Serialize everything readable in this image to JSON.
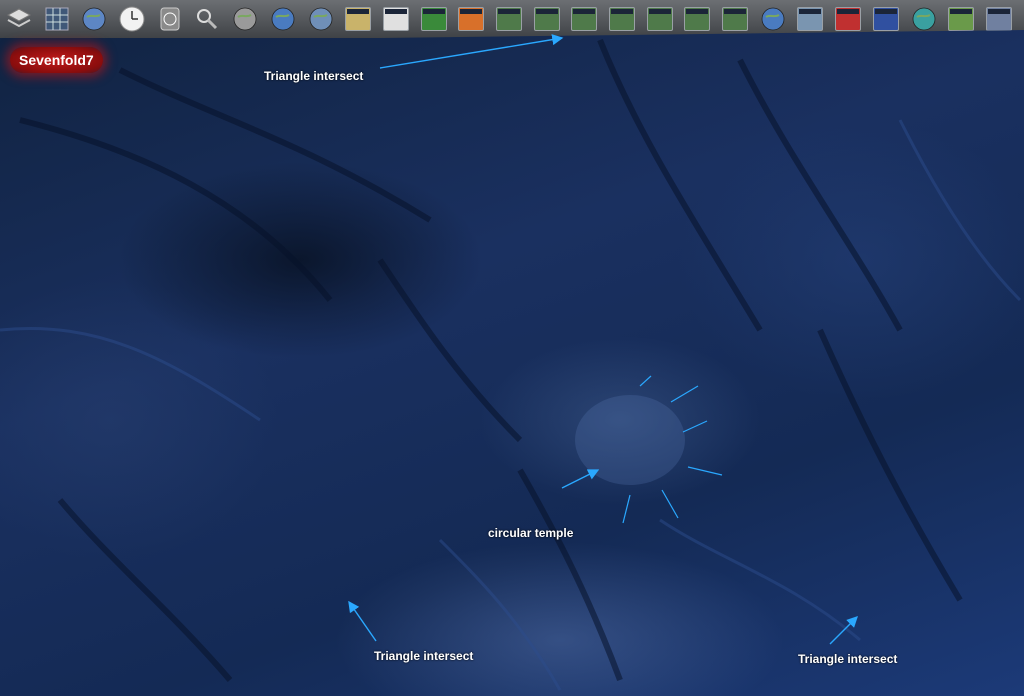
{
  "toolbar": {
    "tools": [
      {
        "id": "layers",
        "icon": "layers-icon"
      },
      {
        "id": "grid",
        "icon": "latlon-grid-icon"
      },
      {
        "id": "globe-grid",
        "icon": "globe-grid-icon"
      },
      {
        "id": "clock",
        "icon": "clock-icon"
      },
      {
        "id": "compass",
        "icon": "compass-icon"
      },
      {
        "id": "search",
        "icon": "magnifier-icon"
      },
      {
        "id": "moon",
        "icon": "moon-icon"
      },
      {
        "id": "earth",
        "icon": "earth-icon"
      },
      {
        "id": "globe2",
        "icon": "globe-icon"
      },
      {
        "id": "satellite",
        "icon": "satellite-icon"
      },
      {
        "id": "modis",
        "icon": "modis-icon"
      },
      {
        "id": "wms",
        "icon": "wms-icon"
      },
      {
        "id": "weather",
        "icon": "weather-map-icon"
      },
      {
        "id": "landsat1",
        "icon": "imagery-thumbnail-icon"
      },
      {
        "id": "landsat2",
        "icon": "imagery-thumbnail-icon"
      },
      {
        "id": "landsat3",
        "icon": "imagery-thumbnail-icon"
      },
      {
        "id": "landsat4",
        "icon": "imagery-thumbnail-icon"
      },
      {
        "id": "landsat5",
        "icon": "imagery-thumbnail-icon"
      },
      {
        "id": "landsat6",
        "icon": "imagery-thumbnail-icon"
      },
      {
        "id": "landsat7",
        "icon": "imagery-thumbnail-icon"
      },
      {
        "id": "globe3",
        "icon": "earth-icon"
      },
      {
        "id": "usgs",
        "icon": "topo-map-icon"
      },
      {
        "id": "flags1",
        "icon": "world-flags-icon"
      },
      {
        "id": "flags2",
        "icon": "country-flags-icon"
      },
      {
        "id": "community",
        "icon": "community-globe-icon"
      },
      {
        "id": "usmap",
        "icon": "us-map-icon"
      },
      {
        "id": "tools",
        "icon": "tools-icon"
      }
    ]
  },
  "badge": {
    "label": "Sevenfold7"
  },
  "annotations": {
    "top": "Triangle intersect",
    "center": "circular temple",
    "bottom_left": "Triangle intersect",
    "bottom_right": "Triangle intersect"
  },
  "colors": {
    "arrow": "#2aa8ff",
    "badge": "#c21a1a"
  }
}
